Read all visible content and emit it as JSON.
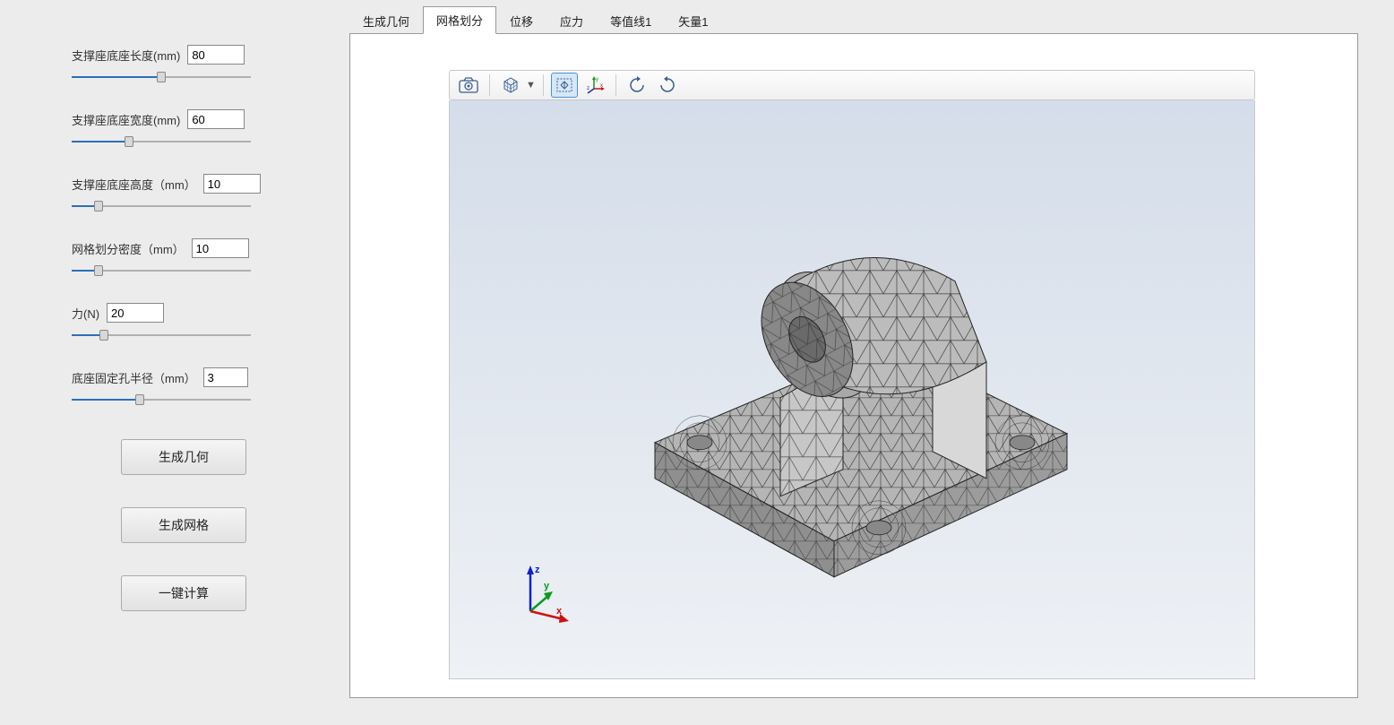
{
  "sidebar": {
    "params": [
      {
        "label": "支撑座底座长度(mm)",
        "value": "80",
        "slider_pct": 50
      },
      {
        "label": "支撑座底座宽度(mm)",
        "value": "60",
        "slider_pct": 32
      },
      {
        "label": "支撑座底座高度（mm）",
        "value": "10",
        "slider_pct": 15
      },
      {
        "label": "网格划分密度（mm）",
        "value": "10",
        "slider_pct": 15
      },
      {
        "label": "力(N)",
        "value": "20",
        "slider_pct": 18
      },
      {
        "label": "底座固定孔半径（mm）",
        "value": "3",
        "slider_pct": 38,
        "narrow": true
      }
    ],
    "buttons": {
      "generate_geometry": "生成几何",
      "generate_mesh": "生成网格",
      "compute_all": "一键计算"
    }
  },
  "tabs": [
    {
      "label": "生成几何",
      "active": false
    },
    {
      "label": "网格划分",
      "active": true
    },
    {
      "label": "位移",
      "active": false
    },
    {
      "label": "应力",
      "active": false
    },
    {
      "label": "等值线1",
      "active": false
    },
    {
      "label": "矢量1",
      "active": false
    }
  ],
  "toolbar": {
    "icons": [
      "camera",
      "cube-view",
      "fit-view",
      "axes-xyz",
      "rotate-ccw",
      "rotate-cw"
    ]
  },
  "axes": {
    "x": "x",
    "y": "y",
    "z": "z"
  }
}
